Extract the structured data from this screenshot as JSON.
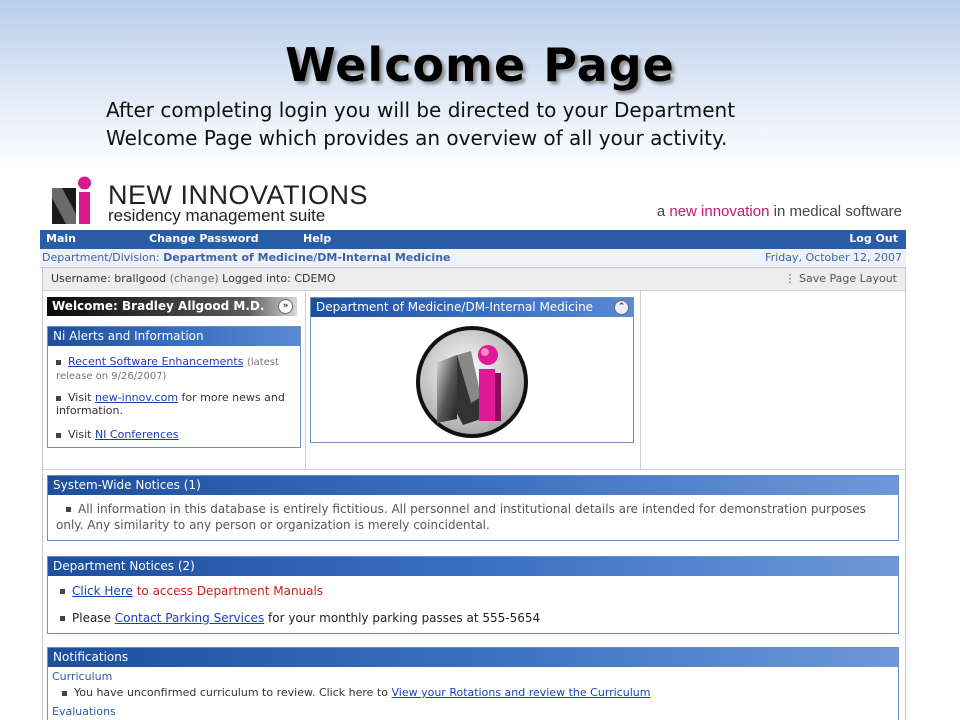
{
  "slide": {
    "title": "Welcome Page",
    "description": "After completing login you will be directed to your Department Welcome Page which provides an overview of all your activity."
  },
  "brand": {
    "name": "NEW INNOVATIONS",
    "subtitle": "residency management suite",
    "tagline_a": "a",
    "tagline_highlight": "new innovation",
    "tagline_rest": "in medical software"
  },
  "nav": {
    "main": "Main",
    "change_password": "Change Password",
    "help": "Help",
    "logout": "Log Out"
  },
  "dept_bar": {
    "label": "Department/Division:",
    "value": "Department of Medicine/DM-Internal Medicine",
    "date": "Friday, October 12, 2007"
  },
  "user_bar": {
    "username_label": "Username:",
    "username": "brallgood",
    "change": "(change)",
    "logged_label": "Logged into:",
    "db": "CDEMO",
    "save_layout": "Save Page Layout"
  },
  "welcome": {
    "title": "Welcome: Bradley Allgood M.D."
  },
  "alerts": {
    "title": "Ni Alerts and Information",
    "item1_link": "Recent Software Enhancements",
    "item1_note": "(latest release on 9/26/2007)",
    "item2_pre": "Visit",
    "item2_link": "new-innov.com",
    "item2_post": "for more news and information.",
    "item3_pre": "Visit",
    "item3_link": "NI Conferences"
  },
  "dept_panel": {
    "title": "Department of Medicine/DM-Internal Medicine"
  },
  "system_notices": {
    "title": "System-Wide Notices (1)",
    "text": "All information in this database is entirely fictitious. All personnel and institutional details are intended for demonstration purposes only. Any similarity to any person or organization is merely coincidental."
  },
  "dept_notices": {
    "title": "Department Notices (2)",
    "item1_link": "Click Here",
    "item1_rest": "to access Department Manuals",
    "item2_pre": "Please",
    "item2_link": "Contact Parking Services",
    "item2_post": "for your monthly parking passes at 555-5654"
  },
  "notifications": {
    "title": "Notifications",
    "curriculum_head": "Curriculum",
    "curriculum_text": "You have unconfirmed curriculum to review. Click here to",
    "curriculum_link": "View your Rotations and review the Curriculum",
    "evaluations_head": "Evaluations"
  },
  "colors": {
    "nav_blue": "#2a5da7",
    "brand_pink": "#c2187a",
    "link_blue": "#1a3fb5"
  }
}
